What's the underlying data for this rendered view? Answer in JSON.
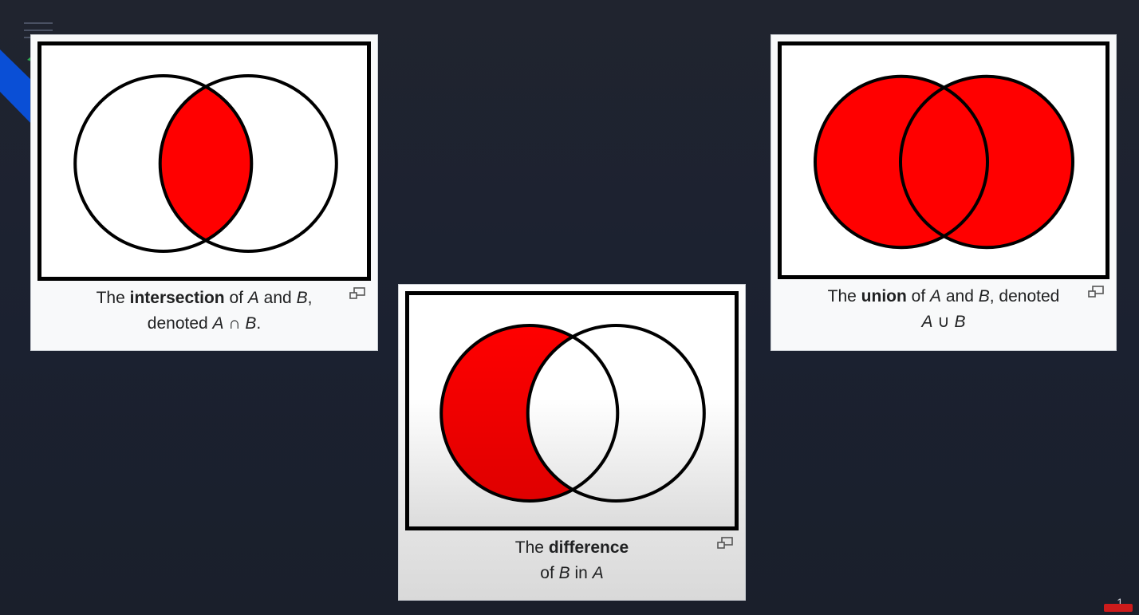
{
  "diagrams": {
    "intersection": {
      "caption_prefix": "The ",
      "caption_bold": "intersection",
      "caption_mid1": " of ",
      "set_a": "A",
      "caption_mid2": " and ",
      "set_b": "B",
      "caption_mid3": ",",
      "caption_line2_prefix": "denoted ",
      "expr_a": "A",
      "expr_op": " ∩ ",
      "expr_b": "B",
      "caption_end": "."
    },
    "difference": {
      "caption_prefix": "The ",
      "caption_bold": "difference",
      "caption_line2_prefix": "of ",
      "set_b": "B",
      "caption_mid": " in ",
      "set_a": "A"
    },
    "union": {
      "caption_prefix": "The ",
      "caption_bold": "union",
      "caption_mid1": " of ",
      "set_a": "A",
      "caption_mid2": " and ",
      "set_b": "B",
      "caption_mid3": ", denoted",
      "expr_a": "A",
      "expr_op": " ∪ ",
      "expr_b": "B"
    }
  },
  "colors": {
    "fill": "#ff0000",
    "outline": "#000000",
    "background": "#1c2130",
    "accent": "#0a4fd6"
  },
  "page_number": "1"
}
